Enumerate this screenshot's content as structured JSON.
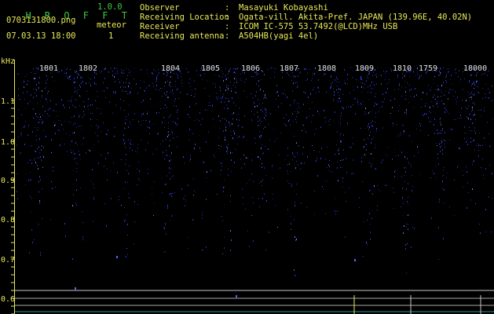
{
  "header": {
    "brand": "H R O F F T",
    "version": "1.0.0",
    "filename": "0703131800.png",
    "datetime": "07.03.13 18:00",
    "meteor_label": "meteor",
    "meteor_count": "1"
  },
  "info": [
    {
      "key": "Observer",
      "value": "Masayuki Kobayashi"
    },
    {
      "key": "Receiving Location",
      "value": "Ogata-vill. Akita-Pref. JAPAN (139.96E, 40.02N)"
    },
    {
      "key": "Receiver",
      "value": "ICOM IC-575 53.7492(@LCD)MHz USB"
    },
    {
      "key": "Receiving antenna",
      "value": "A504HB(yagi 4el)"
    }
  ],
  "spectrogram": {
    "axis_unit": "kHz",
    "y_ticks": [
      "1.1",
      "1.0",
      "0.9",
      "0.8",
      "0.7",
      "0.6"
    ],
    "time_labels": [
      "1801",
      "1802",
      "1804",
      "1805",
      "1806",
      "1807",
      "1808",
      "1809",
      "1810",
      "1759",
      "18000"
    ],
    "colors": {
      "background": "#000000",
      "signal": "#3344ff",
      "axis_text": "#e8e85a",
      "header_text": "#3cc83c"
    }
  }
}
